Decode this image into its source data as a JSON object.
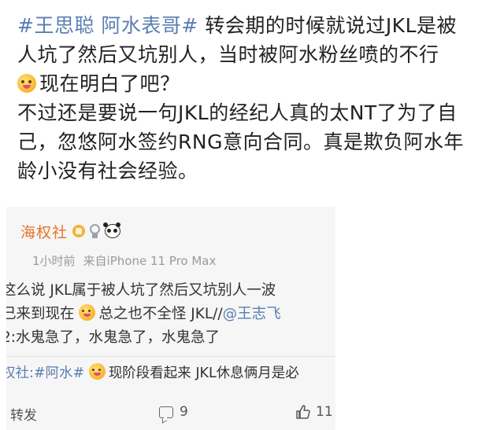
{
  "post": {
    "topic1": "#王思聪",
    "topic2": "阿水表哥#",
    "line1_rest": "转会期的时候就说过JKL是被",
    "line2": "人坑了然后又坑别人，当时被阿水粉丝喷的不行",
    "line3": "现在明白了吧？",
    "line4": "不过还是要说一句JKL的经纪人真的太NT了为了自",
    "line5": "己，忽悠阿水签约RNG意向合同。真是欺负阿水年",
    "line6": "龄小没有社会经验。"
  },
  "card": {
    "author": "海权社",
    "time": "1小时前",
    "source": "来自iPhone 11 Pro Max",
    "repost_line1": "这么说 JKL属于被人坑了然后又坑别人一波",
    "repost_line2a": "己来到现在",
    "repost_line2b": "总之也不全怪 JKL//",
    "repost_mention": "@王志飞",
    "repost_line3": "2:水鬼急了，水鬼急了，水鬼急了",
    "comment_user": "权社:#阿水#",
    "comment_text": "现阶段看起来 JKL休息俩月是必"
  },
  "actions": {
    "repost_label": "转发",
    "comment_count": "9",
    "like_count": "11"
  },
  "icons": [
    "grin-emoji-icon",
    "vip-badge-icon",
    "medal-icon",
    "panda-icon",
    "comment-icon",
    "like-icon"
  ],
  "colors": {
    "topic": "#5b7eb3",
    "author": "#e8732a",
    "meta": "#9a9a9a"
  }
}
